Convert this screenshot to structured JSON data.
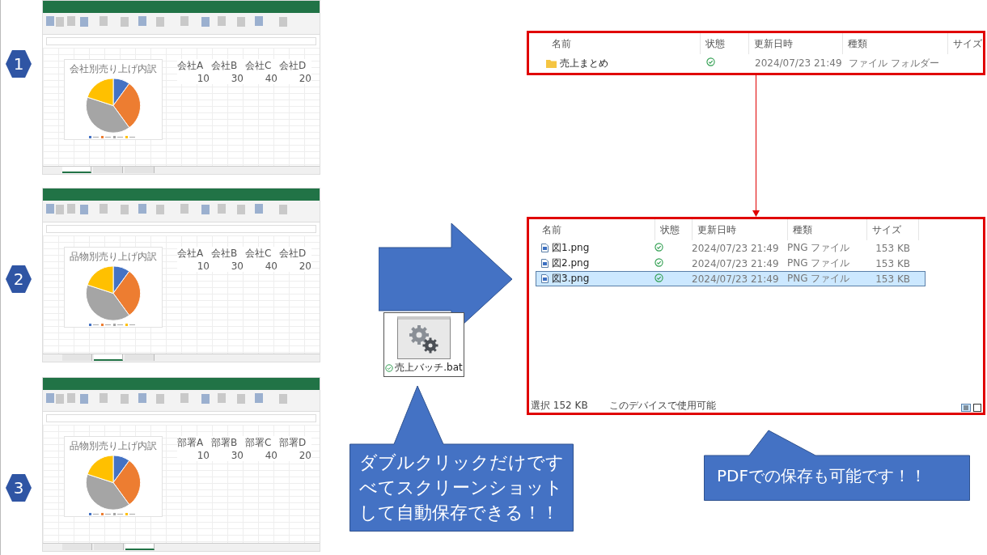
{
  "steps": [
    {
      "number": "1",
      "sheet": {
        "chart_data": {
          "type": "pie",
          "title": "会社別売り上げ内訳",
          "categories": [
            "会社A",
            "会社B",
            "会社C",
            "会社D"
          ],
          "values": [
            10,
            30,
            40,
            20
          ]
        },
        "value_cells": [
          "10",
          "30",
          "40",
          "20"
        ],
        "sheet_tabs": [
          {
            "selected": true
          },
          {
            "selected": false
          },
          {
            "selected": false
          }
        ]
      }
    },
    {
      "number": "2",
      "sheet": {
        "chart_data": {
          "type": "pie",
          "title": "品物別売り上げ内訳",
          "categories": [
            "会社A",
            "会社B",
            "会社C",
            "会社D"
          ],
          "values": [
            10,
            30,
            40,
            20
          ]
        },
        "value_cells": [
          "10",
          "30",
          "40",
          "20"
        ],
        "sheet_tabs": [
          {
            "selected": false
          },
          {
            "selected": true
          },
          {
            "selected": false
          }
        ]
      }
    },
    {
      "number": "3",
      "sheet": {
        "chart_data": {
          "type": "pie",
          "title": "品物別売り上げ内訳",
          "categories": [
            "部署A",
            "部署B",
            "部署C",
            "部署D"
          ],
          "values": [
            10,
            30,
            40,
            20
          ]
        },
        "value_cells": [
          "10",
          "30",
          "40",
          "20"
        ],
        "sheet_tabs": [
          {
            "selected": false
          },
          {
            "selected": false
          },
          {
            "selected": true
          }
        ]
      }
    }
  ],
  "batch_file": {
    "name": "売上バッチ.bat",
    "synced": true
  },
  "callouts": [
    {
      "text": "ダブルクリックだけですべてスクリーンショットして自動保存できる！！"
    },
    {
      "text": "PDFでの保存も可能です！！"
    }
  ],
  "explorers": [
    {
      "columns": [
        "名前",
        "状態",
        "更新日時",
        "種類",
        "サイズ"
      ],
      "rows": [
        {
          "kind": "folder",
          "name": "売上まとめ",
          "synced": true,
          "modified": "2024/07/23 21:49",
          "type": "ファイル フォルダー",
          "size": "",
          "selected": false
        }
      ]
    },
    {
      "columns": [
        "名前",
        "状態",
        "更新日時",
        "種類",
        "サイズ"
      ],
      "rows": [
        {
          "kind": "image",
          "name": "図1.png",
          "synced": true,
          "modified": "2024/07/23 21:49",
          "type": "PNG ファイル",
          "size": "153 KB",
          "selected": false
        },
        {
          "kind": "image",
          "name": "図2.png",
          "synced": true,
          "modified": "2024/07/23 21:49",
          "type": "PNG ファイル",
          "size": "153 KB",
          "selected": false
        },
        {
          "kind": "image",
          "name": "図3.png",
          "synced": true,
          "modified": "2024/07/23 21:49",
          "type": "PNG ファイル",
          "size": "153 KB",
          "selected": true
        }
      ],
      "status_bar": [
        "選択 152 KB",
        "このデバイスで使用可能"
      ]
    }
  ]
}
